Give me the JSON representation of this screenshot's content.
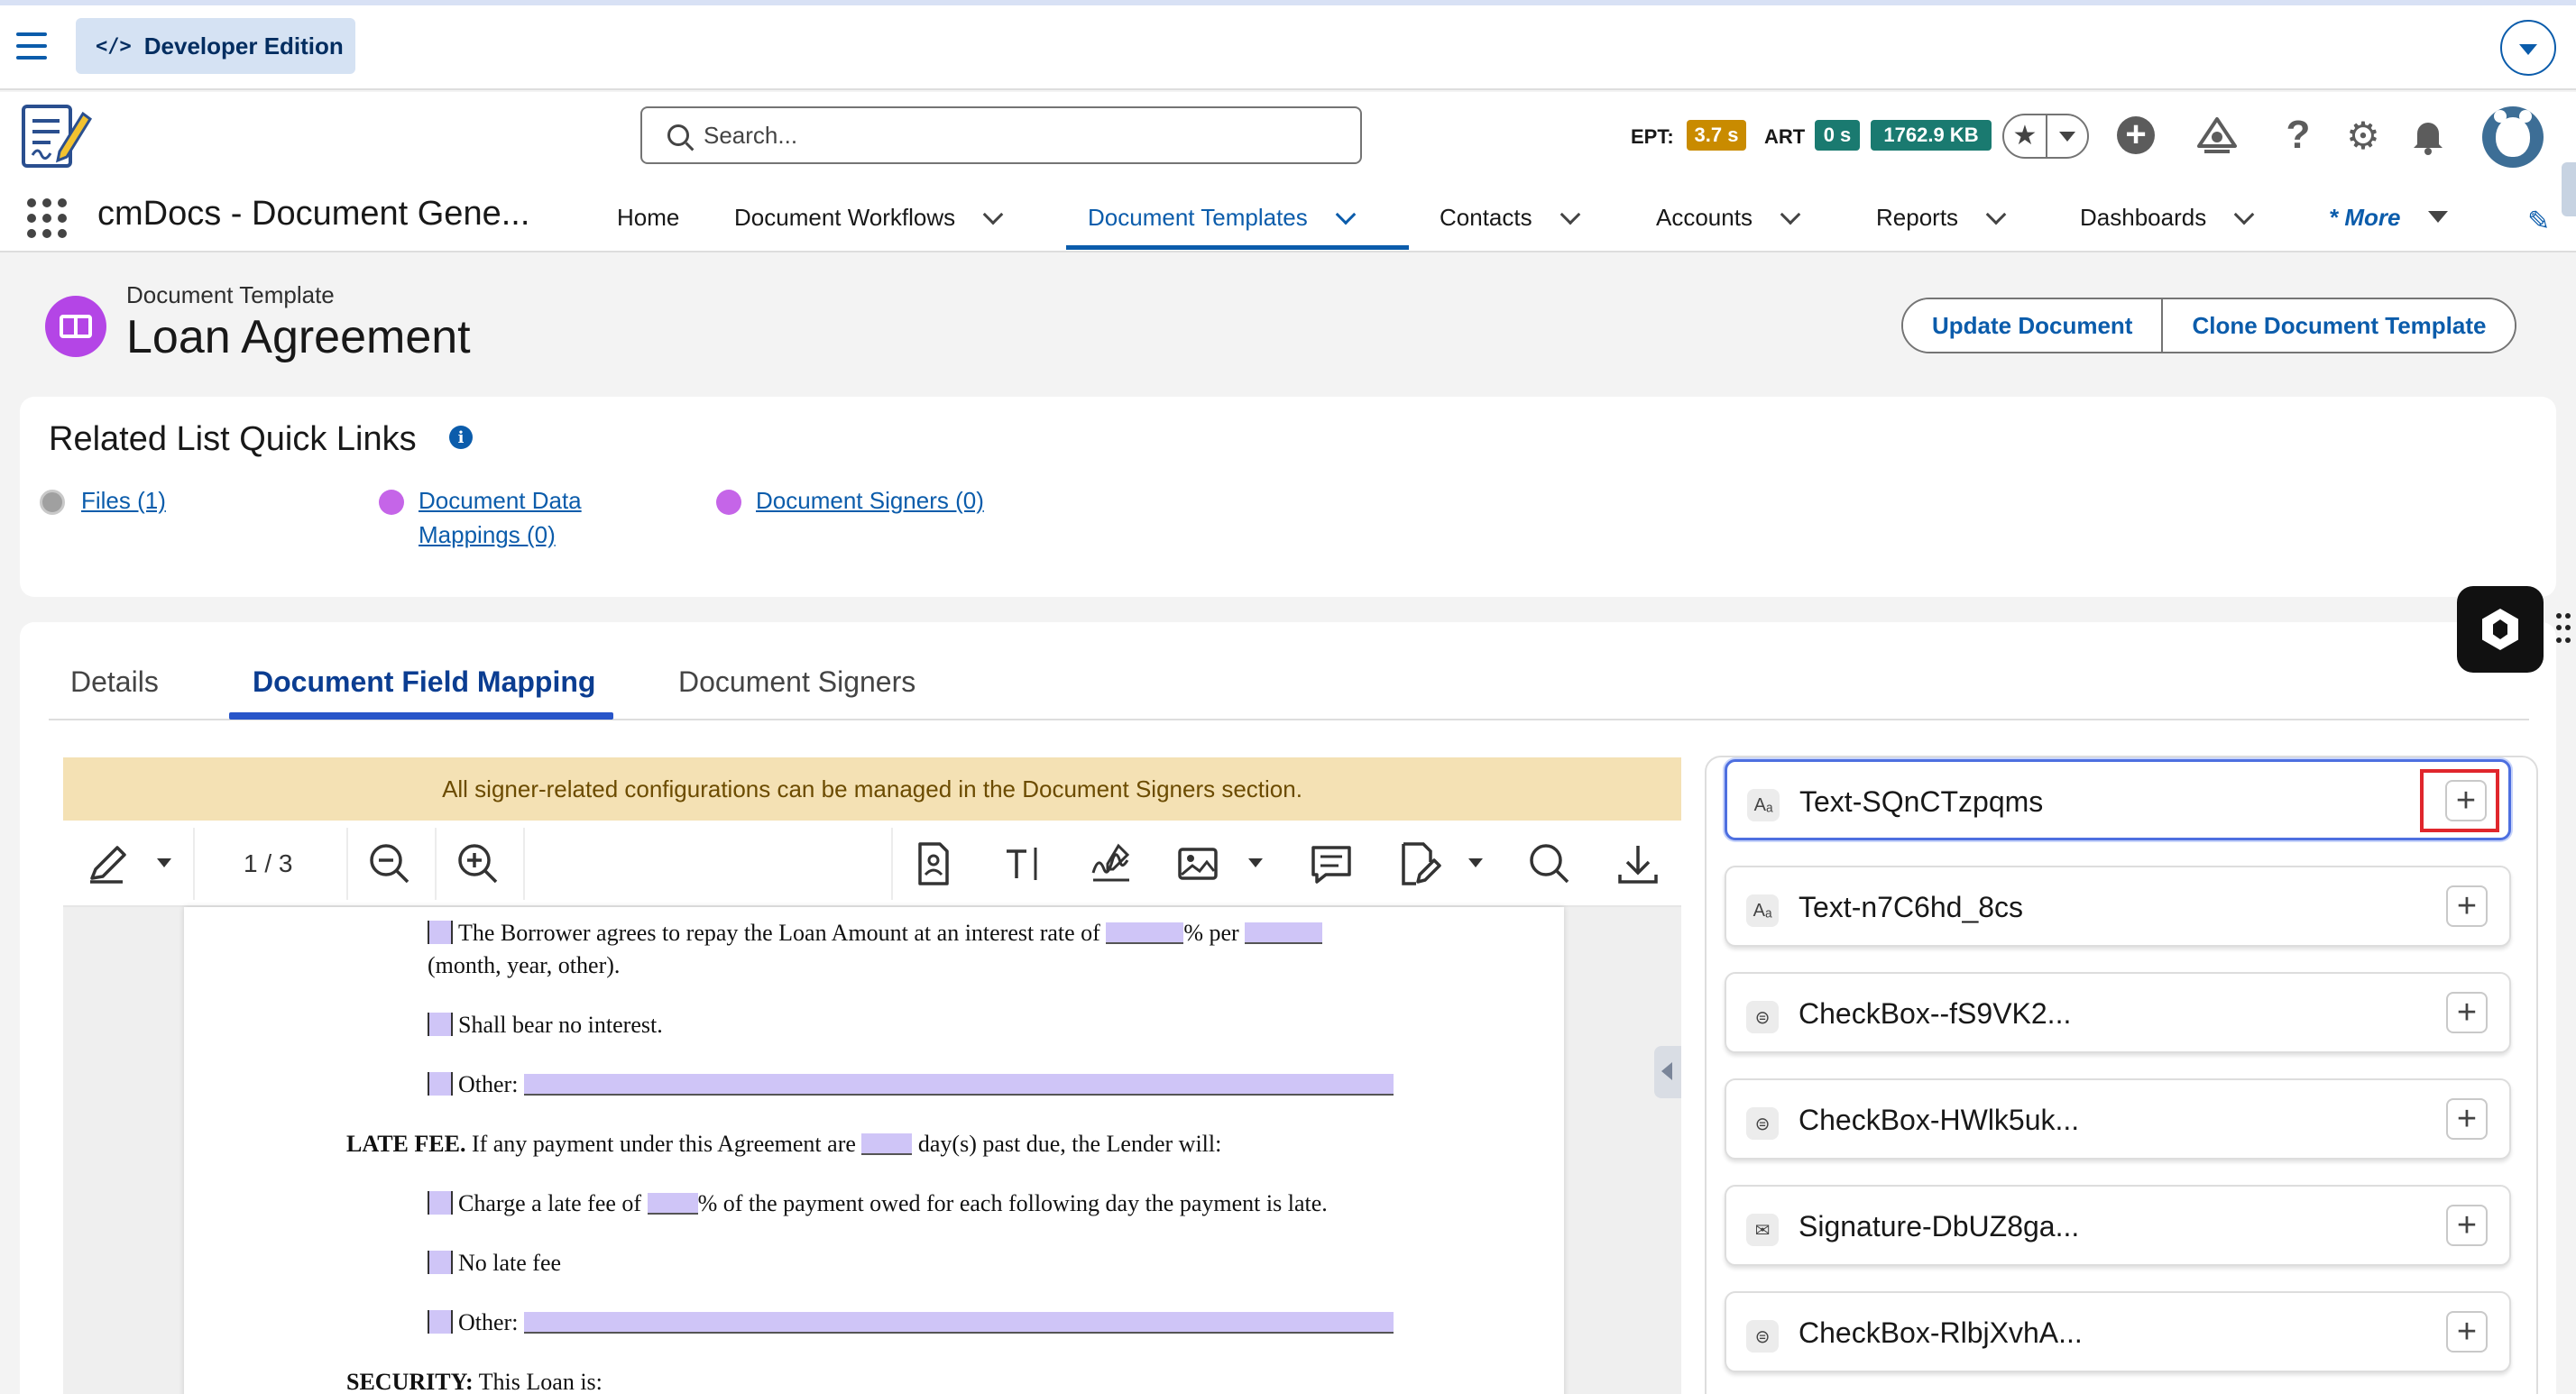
{
  "devbar": {
    "edition_label": "Developer Edition"
  },
  "search": {
    "placeholder": "Search..."
  },
  "metrics": {
    "ept_label": "EPT:",
    "ept_value": "3.7 s",
    "art_label": "ART",
    "art_value": "0 s",
    "size_value": "1762.9 KB"
  },
  "nav": {
    "app_name": "cmDocs - Document Gene...",
    "items": [
      {
        "label": "Home"
      },
      {
        "label": "Document Workflows"
      },
      {
        "label": "Document Templates"
      },
      {
        "label": "Contacts"
      },
      {
        "label": "Accounts"
      },
      {
        "label": "Reports"
      },
      {
        "label": "Dashboards"
      }
    ],
    "more_label": "* More"
  },
  "record": {
    "type_label": "Document Template",
    "title": "Loan Agreement",
    "actions": [
      "Update Document",
      "Clone Document Template"
    ]
  },
  "quick_links": {
    "title": "Related List Quick Links",
    "links": [
      {
        "line1": "Files (1)",
        "line2": ""
      },
      {
        "line1": "Document Data",
        "line2": "Mappings (0)"
      },
      {
        "line1": "Document Signers (0)",
        "line2": ""
      }
    ]
  },
  "tabs": [
    "Details",
    "Document Field Mapping",
    "Document Signers"
  ],
  "banner": "All signer-related configurations can be managed in the Document Signers section.",
  "viewer": {
    "page_indicator": "1 / 3"
  },
  "document": {
    "l1a": "The Borrower agrees to repay the Loan Amount at an interest rate of",
    "l1b": "% per",
    "l2": "(month, year, other).",
    "l3": "Shall bear no interest.",
    "l4": "Other:",
    "l5_bold": "LATE FEE.",
    "l5a": "If any payment under this Agreement are",
    "l5b": "day(s) past due, the Lender will:",
    "l6a": "Charge a late fee of",
    "l6b": "% of the payment owed for each following day the payment is late.",
    "l7": "No late fee",
    "l8": "Other:",
    "l9_bold": "SECURITY:",
    "l9": "This Loan is:"
  },
  "fields": [
    {
      "name": "Text-SQnCTzpqms",
      "icon": "text-field-icon",
      "glyph": "Aₐ"
    },
    {
      "name": "Text-n7C6hd_8cs",
      "icon": "text-field-icon",
      "glyph": "Aₐ"
    },
    {
      "name": "CheckBox--fS9VK2...",
      "icon": "toggle-icon",
      "glyph": "⊜"
    },
    {
      "name": "CheckBox-HWlk5uk...",
      "icon": "toggle-icon",
      "glyph": "⊜"
    },
    {
      "name": "Signature-DbUZ8ga...",
      "icon": "signature-icon",
      "glyph": "✉"
    },
    {
      "name": "CheckBox-RlbjXvhA...",
      "icon": "toggle-icon",
      "glyph": "⊜"
    }
  ],
  "colors": {
    "brand": "#0b5cab",
    "active_tab": "#2855c9",
    "ept_badge": "#c98b00",
    "art_badge": "#1a7a70",
    "highlight": "#e0262c",
    "form_fill": "#cfc5f7"
  }
}
